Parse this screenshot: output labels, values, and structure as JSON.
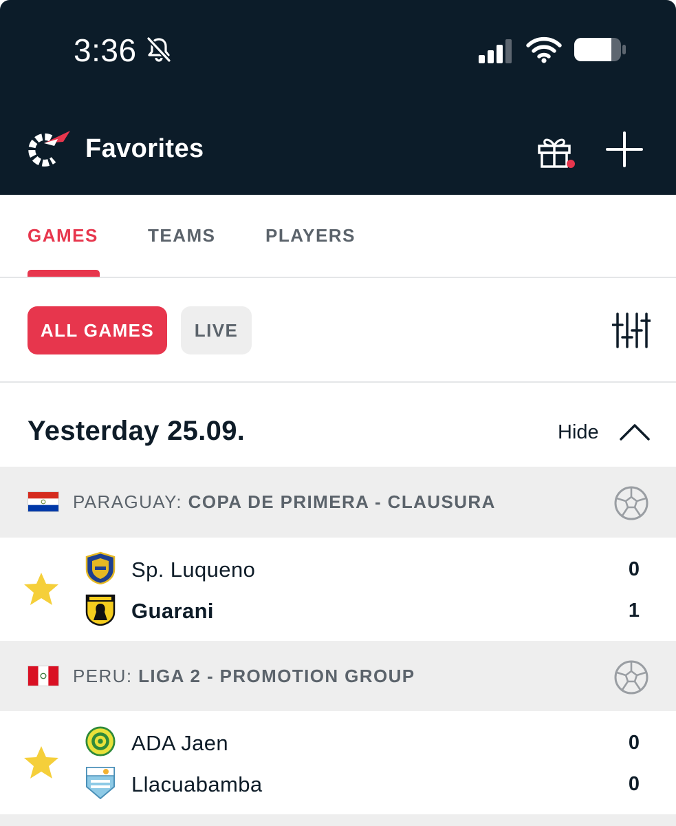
{
  "status_bar": {
    "time": "3:36"
  },
  "app_bar": {
    "title": "Favorites"
  },
  "tabs": [
    {
      "label": "GAMES",
      "active": true
    },
    {
      "label": "TEAMS",
      "active": false
    },
    {
      "label": "PLAYERS",
      "active": false
    }
  ],
  "filters": [
    {
      "label": "ALL GAMES",
      "active": true
    },
    {
      "label": "LIVE",
      "active": false
    }
  ],
  "date_section": {
    "title": "Yesterday 25.09.",
    "toggle_label": "Hide"
  },
  "leagues": [
    {
      "country": "PARAGUAY:",
      "name": "COPA DE PRIMERA - CLAUSURA",
      "match": {
        "favorite": true,
        "home": {
          "name": "Sp. Luqueno",
          "score": "0",
          "winner": false
        },
        "away": {
          "name": "Guarani",
          "score": "1",
          "winner": true
        }
      }
    },
    {
      "country": "PERU:",
      "name": "LIGA 2 - PROMOTION GROUP",
      "match": {
        "favorite": true,
        "home": {
          "name": "ADA Jaen",
          "score": "0",
          "winner": false
        },
        "away": {
          "name": "Llacuabamba",
          "score": "0",
          "winner": false
        }
      }
    }
  ],
  "colors": {
    "header_bg": "#0c1c29",
    "accent": "#e7364d",
    "favorite_star": "#f5cf3a",
    "section_bg": "#eeeeee",
    "muted_text": "#5b636b"
  },
  "icons": {
    "status": [
      "bell-slash-icon",
      "cellular-signal-icon",
      "wifi-icon",
      "battery-icon"
    ],
    "app_bar": [
      "flashscore-logo-icon",
      "gift-icon",
      "plus-icon"
    ],
    "filters": "filter-sliders-icon",
    "section_toggle": "chevron-up-icon",
    "sport": "soccer-ball-icon",
    "favorite": "star-icon"
  }
}
